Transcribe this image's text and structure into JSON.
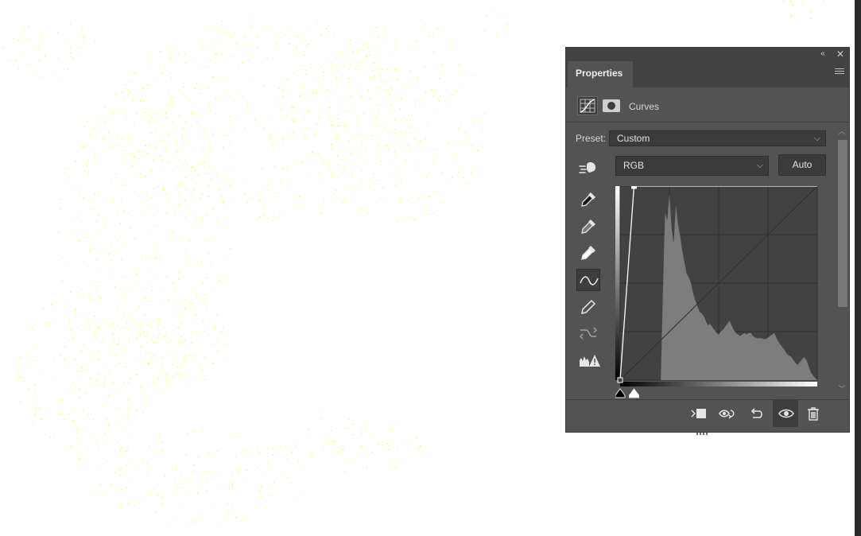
{
  "panel": {
    "tab_label": "Properties",
    "collapse_glyph": "«",
    "close_glyph": "✕",
    "menu_icon": "panel-menu-icon",
    "adjustment_title": "Curves",
    "mode_icons": [
      "curves-adjustment-icon",
      "layer-mask-icon"
    ]
  },
  "controls": {
    "preset_label": "Preset:",
    "preset_value": "Custom",
    "channel_value": "RGB",
    "auto_label": "Auto",
    "chevron_glyph": "⌵"
  },
  "tools": [
    "on-image-adjustment-icon",
    "black-point-eyedropper-icon",
    "gray-point-eyedropper-icon",
    "white-point-eyedropper-icon",
    "edit-points-curve-icon",
    "pencil-draw-icon",
    "smooth-curve-icon",
    "clipping-warning-icon"
  ],
  "bottom_bar": [
    "clip-to-layer-icon",
    "view-previous-state-icon",
    "reset-adjustment-icon",
    "toggle-visibility-icon",
    "delete-icon"
  ],
  "curve": {
    "input_range": [
      0,
      255
    ],
    "output_range": [
      0,
      255
    ],
    "points": [
      [
        0,
        0
      ],
      [
        18,
        255
      ],
      [
        255,
        255
      ]
    ],
    "black_slider": 0,
    "white_slider": 18,
    "grid_divisions": 4
  },
  "histogram": [
    0,
    0,
    0,
    0,
    0,
    0,
    0,
    0,
    0,
    0,
    0,
    0,
    0,
    0,
    0,
    0,
    0,
    0,
    0,
    0,
    120,
    220,
    210,
    245,
    200,
    180,
    230,
    205,
    190,
    170,
    155,
    140,
    135,
    128,
    115,
    105,
    98,
    90,
    88,
    84,
    78,
    72,
    74,
    70,
    66,
    62,
    60,
    64,
    66,
    70,
    74,
    78,
    72,
    66,
    62,
    60,
    58,
    60,
    62,
    60,
    62,
    62,
    58,
    56,
    55,
    55,
    55,
    54,
    54,
    56,
    58,
    60,
    62,
    55,
    50,
    46,
    42,
    38,
    34,
    32,
    30,
    26,
    22,
    20,
    24,
    28,
    30,
    26,
    18,
    10,
    6,
    3,
    0
  ],
  "colors": {
    "panel_bg": "#535353",
    "title_bg": "#424242",
    "graph_bg": "#424242",
    "histogram_fill": "#7d7d7d",
    "curve_line": "#ffffff",
    "canvas_speckle": "#ffff00"
  }
}
